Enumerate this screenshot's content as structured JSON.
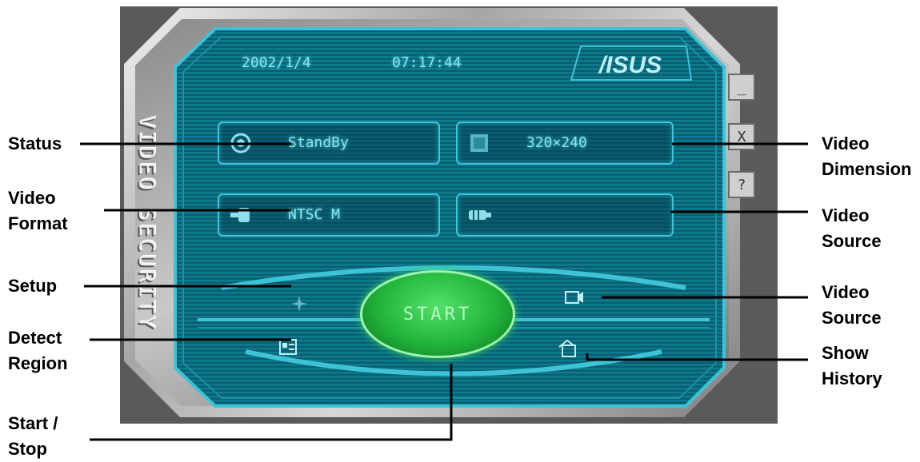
{
  "app": {
    "side_title": "VIDEO SECURITY",
    "logo": "/ISUS",
    "date": "2002/1/4",
    "time": "07:17:44",
    "status_value": "StandBy",
    "dimension_value": "320×240",
    "format_value": "NTSC M",
    "source_value": "",
    "start_label": "START",
    "side_buttons": {
      "minimize": "_",
      "close": "X",
      "help": "?"
    }
  },
  "callouts": {
    "status": [
      "Status"
    ],
    "video_format": [
      "Video",
      "Format"
    ],
    "setup": [
      "Setup"
    ],
    "detect_region": [
      "Detect",
      "Region"
    ],
    "start_stop": [
      "Start /",
      "Stop"
    ],
    "video_dimension": [
      "Video",
      "Dimension"
    ],
    "video_source_top": [
      "Video",
      "Source"
    ],
    "video_source_bottom": [
      "Video",
      "Source"
    ],
    "show_history": [
      "Show",
      "History"
    ]
  },
  "colors": {
    "lcd_text": "#8fe0ea",
    "panel_border": "#3ec2d6",
    "start_green": "#22b43a",
    "screen_bg": "#0b5e70"
  }
}
